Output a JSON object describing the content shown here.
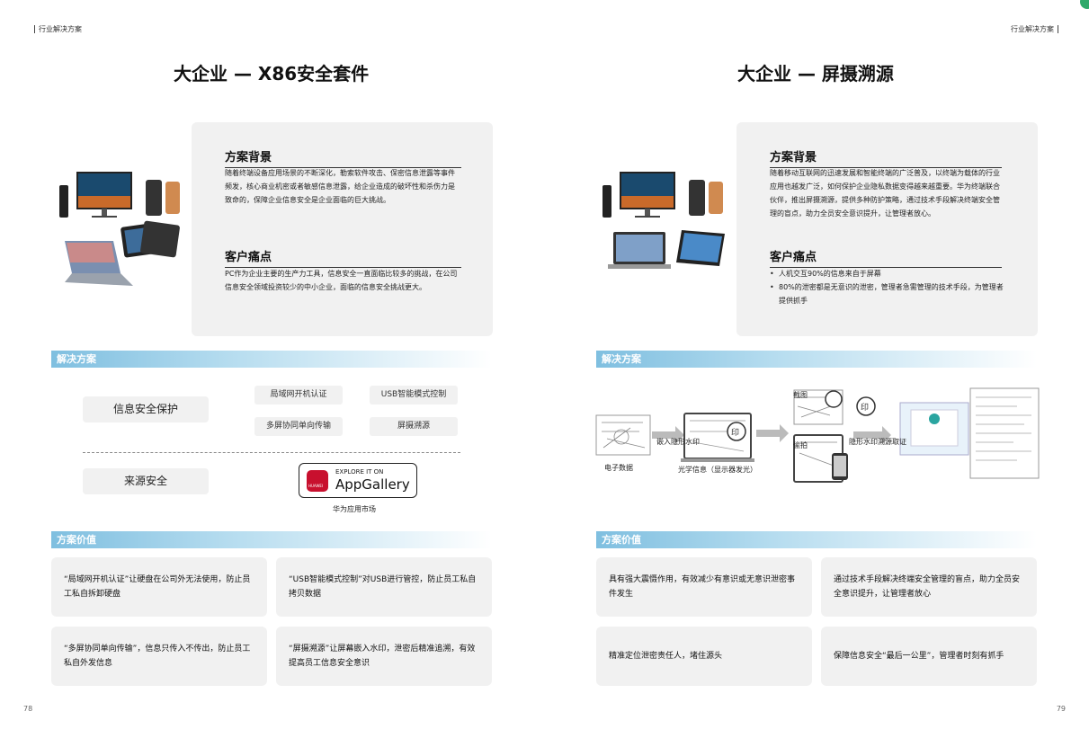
{
  "left": {
    "header": "行业解决方案",
    "title": "大企业 — X86安全套件",
    "background_heading": "方案背景",
    "background_text": "随着终端设备应用场景的不断深化，勒索软件攻击、保密信息泄露等事件频发，核心商业机密或者敏感信息泄露，给企业造成的破坏性和杀伤力是致命的，保障企业信息安全是企业面临的巨大挑战。",
    "pain_heading": "客户痛点",
    "pain_text": "PC作为企业主要的生产力工具，信息安全一直面临比较多的挑战，在公司信息安全领域投资较少的中小企业，面临的信息安全挑战更大。",
    "solution_band": "解决方案",
    "pill_info_security": "信息安全保护",
    "pill_source_security": "来源安全",
    "chips": [
      "局域网开机认证",
      "USB智能模式控制",
      "多屏协同单向传输",
      "屏摄溯源"
    ],
    "appgallery": {
      "small": "EXPLORE IT ON",
      "big": "AppGallery",
      "brand": "HUAWEI",
      "caption": "华为应用市场"
    },
    "value_band": "方案价值",
    "values": [
      "“局域网开机认证”让硬盘在公司外无法使用，防止员工私自拆卸硬盘",
      "“USB智能模式控制”对USB进行管控，防止员工私自拷贝数据",
      "“多屏协同单向传输”，信息只传入不传出，防止员工私自外发信息",
      "“屏摄溯源”让屏幕嵌入水印，泄密后精准追溯，有效提高员工信息安全意识"
    ],
    "page_number": "78"
  },
  "right": {
    "header": "行业解决方案",
    "title": "大企业 — 屏摄溯源",
    "background_heading": "方案背景",
    "background_text": "随着移动互联网的迅速发展和智能终端的广泛普及，以终端为载体的行业应用也越发广泛，如何保护企业隐私数据变得越来越重要。华为终端联合伙伴，推出屏摄溯源，提供多种防护策略，通过技术手段解决终端安全管理的盲点，助力全员安全意识提升，让管理者放心。",
    "pain_heading": "客户痛点",
    "pain_items": [
      "人机交互90%的信息来自于屏幕",
      "80%的泄密都是无意识的泄密，管理者急需管理的技术手段，为管理者提供抓手"
    ],
    "solution_band": "解决方案",
    "diagram": {
      "label_embed": "嵌入隐形水印",
      "label_electronic": "电子数据",
      "label_optical": "光学信息（显示器发光）",
      "label_screenshot": "截图",
      "label_photo": "偷拍",
      "label_extract": "隐形水印溯源取证"
    },
    "value_band": "方案价值",
    "values": [
      "具有强大震慑作用，有效减少有意识或无意识泄密事件发生",
      "通过技术手段解决终端安全管理的盲点，助力全员安全意识提升，让管理者放心",
      "精准定位泄密责任人，堵住源头",
      "保障信息安全“最后一公里”，管理者时刻有抓手"
    ],
    "page_number": "79"
  },
  "colors": {
    "band": "#7fbfe0",
    "card": "#f1f1f1",
    "accent_green": "#2eaa6a"
  }
}
